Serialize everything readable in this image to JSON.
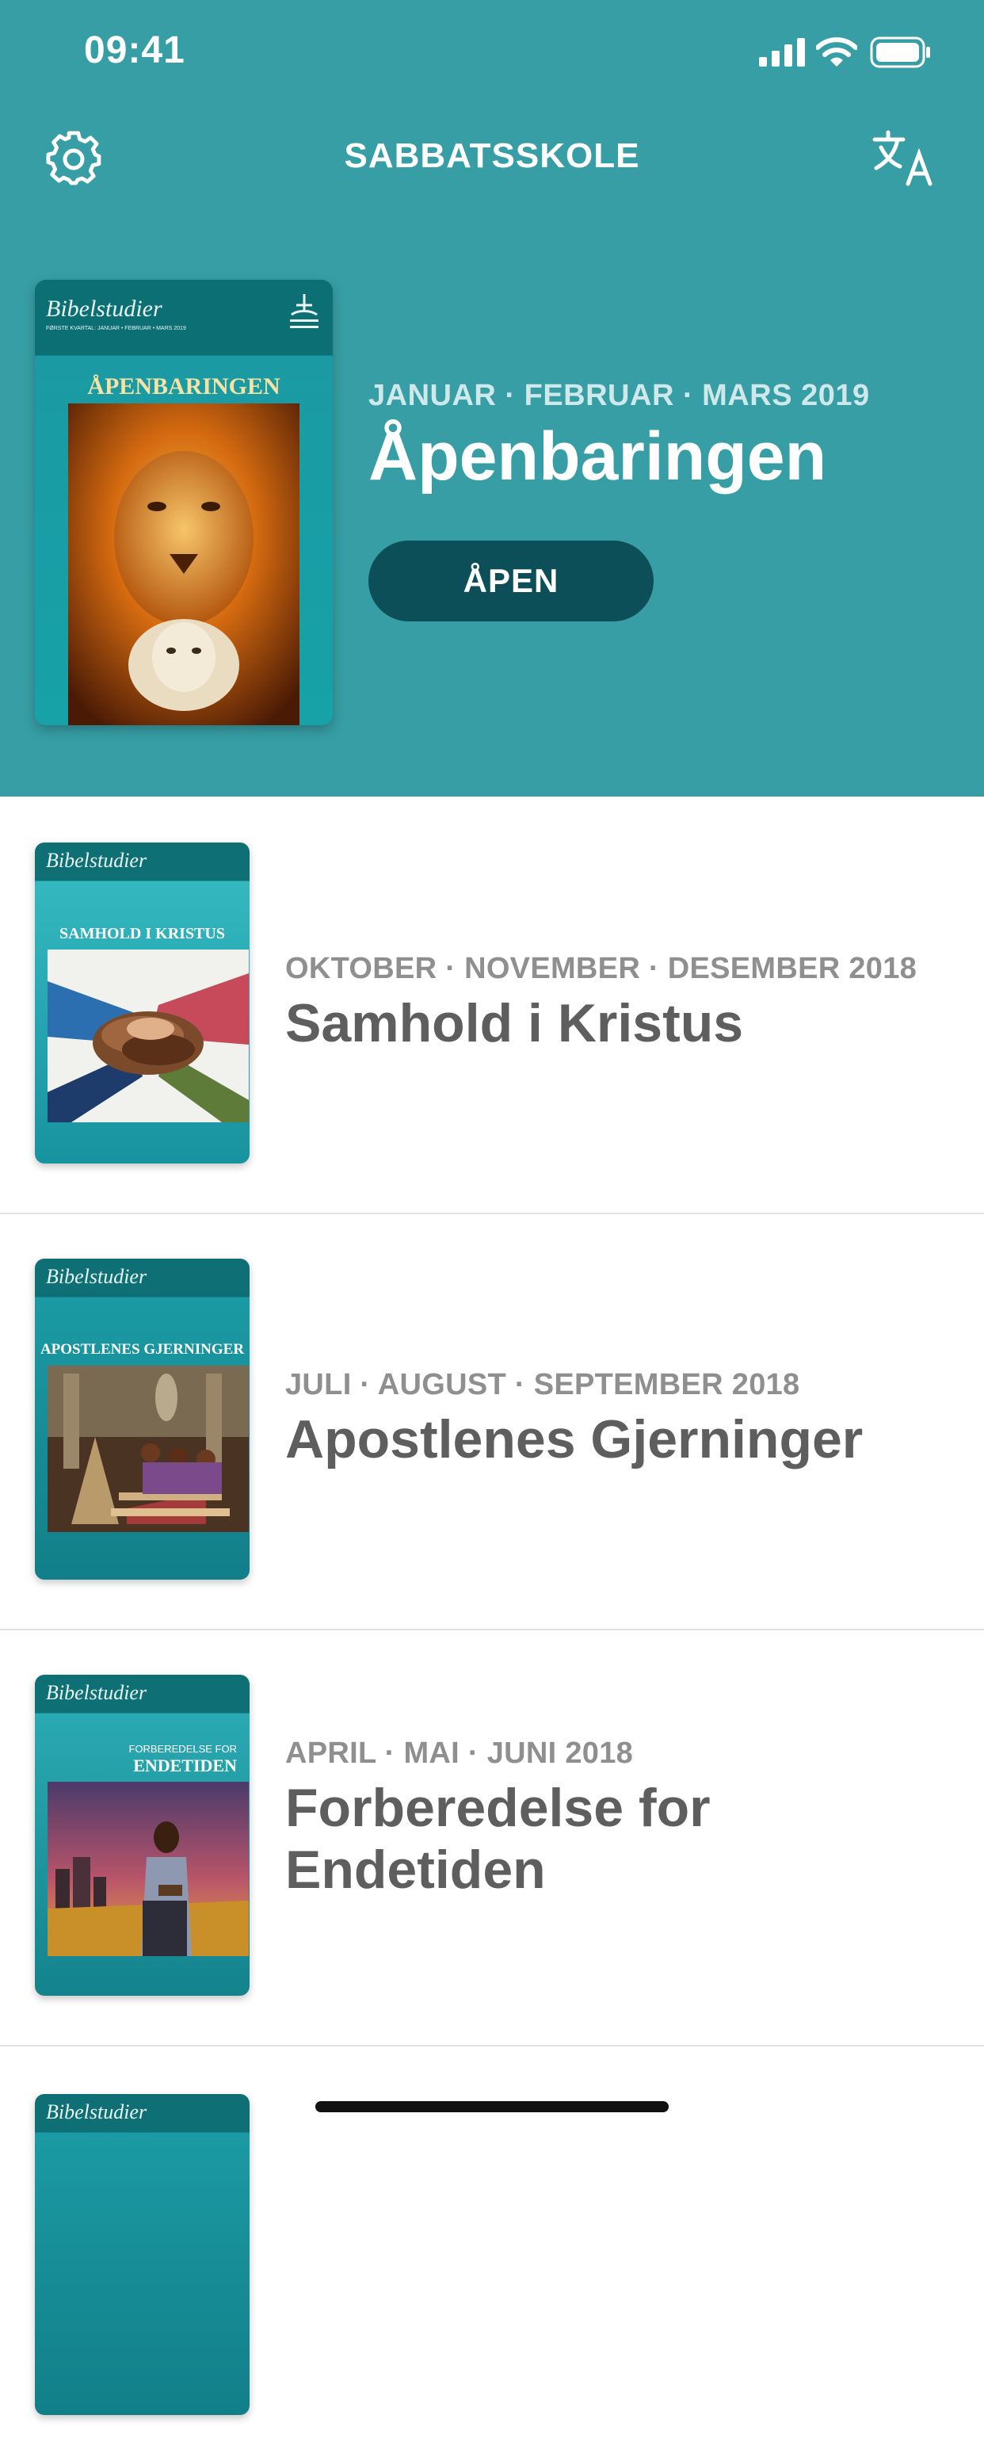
{
  "status_bar": {
    "time": "09:41"
  },
  "nav": {
    "title": "SABBATSSKOLE"
  },
  "icons": {
    "settings": "gear-icon",
    "language": "translate-icon",
    "signal": "signal-icon",
    "wifi": "wifi-icon",
    "battery": "battery-icon"
  },
  "colors": {
    "header": "#379ea5",
    "button": "#0d4f58",
    "title_gray": "#5e5e5e",
    "quarter_gray": "#8f8f8f"
  },
  "featured": {
    "quarter": "JANUAR · FEBRUAR · MARS 2019",
    "title": "Åpenbaringen",
    "button_label": "ÅPEN",
    "cover": {
      "brand": "Bibelstudier",
      "subtitle": "FØRSTE KVARTAL: JANUAR • FEBRUAR • MARS 2019",
      "name": "ÅPENBARINGEN"
    }
  },
  "lessons": [
    {
      "quarter": "OKTOBER · NOVEMBER · DESEMBER 2018",
      "title": "Samhold i Kristus",
      "cover": {
        "brand": "Bibelstudier",
        "name": "SAMHOLD I KRISTUS"
      }
    },
    {
      "quarter": "JULI · AUGUST · SEPTEMBER 2018",
      "title": "Apostlenes Gjerninger",
      "cover": {
        "brand": "Bibelstudier",
        "name": "APOSTLENES GJERNINGER"
      }
    },
    {
      "quarter": "APRIL · MAI · JUNI 2018",
      "title": "Forberedelse for Endetiden",
      "cover": {
        "brand": "Bibelstudier",
        "pre": "FORBEREDELSE FOR",
        "name": "ENDETIDEN"
      }
    },
    {
      "cover": {
        "brand": "Bibelstudier"
      }
    }
  ]
}
